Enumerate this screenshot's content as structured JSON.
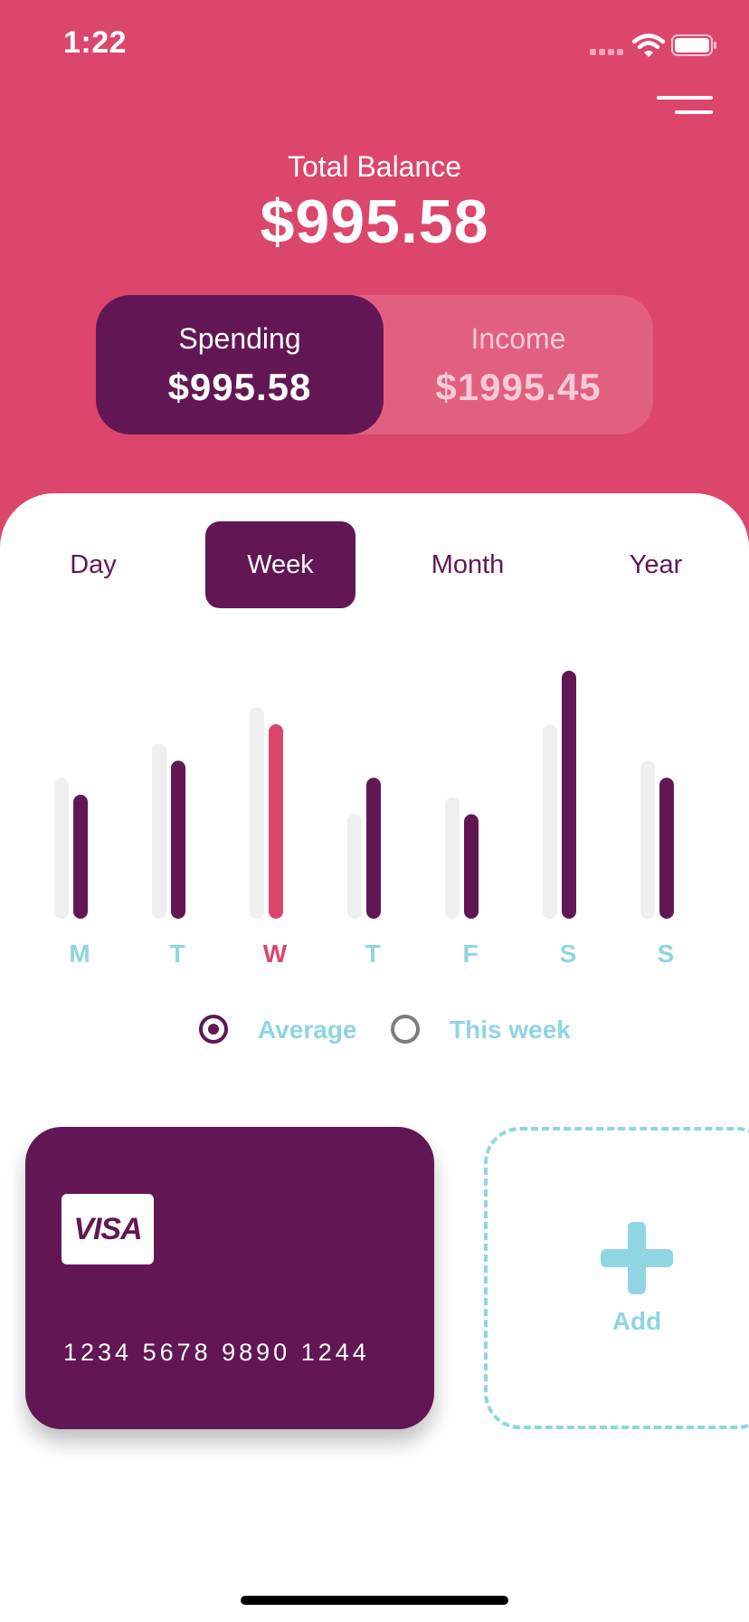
{
  "status_bar": {
    "time": "1:22"
  },
  "header": {
    "balance_label": "Total Balance",
    "balance_value": "$995.58",
    "spending": {
      "label": "Spending",
      "value": "$995.58"
    },
    "income": {
      "label": "Income",
      "value": "$1995.45"
    },
    "selected": "spending"
  },
  "period_tabs": [
    {
      "label": "Day"
    },
    {
      "label": "Week"
    },
    {
      "label": "Month"
    },
    {
      "label": "Year"
    }
  ],
  "selected_period": "Week",
  "chart_data": {
    "type": "bar",
    "categories": [
      "M",
      "T",
      "W",
      "T",
      "F",
      "S",
      "S"
    ],
    "highlight_index": 2,
    "series": [
      {
        "name": "Average",
        "values": [
          58,
          72,
          87,
          43,
          50,
          80,
          65
        ]
      },
      {
        "name": "This week",
        "values": [
          51,
          65,
          80,
          58,
          43,
          102,
          58
        ]
      }
    ],
    "ylim": [
      0,
      105
    ],
    "colors": {
      "average": "#efefef",
      "this_week": "#621754",
      "highlight": "#dc466b",
      "label": "#8fd5e2",
      "label_highlight": "#dc466b"
    }
  },
  "legend": {
    "average_label": "Average",
    "this_week_label": "This week",
    "selected": "Average"
  },
  "cards": {
    "visa_logo": "VISA",
    "card_number": "1234 5678 9890 1244",
    "add_label": "Add"
  },
  "colors": {
    "header_bg": "#dc466b",
    "primary": "#621754",
    "accent": "#8fd5e2"
  }
}
